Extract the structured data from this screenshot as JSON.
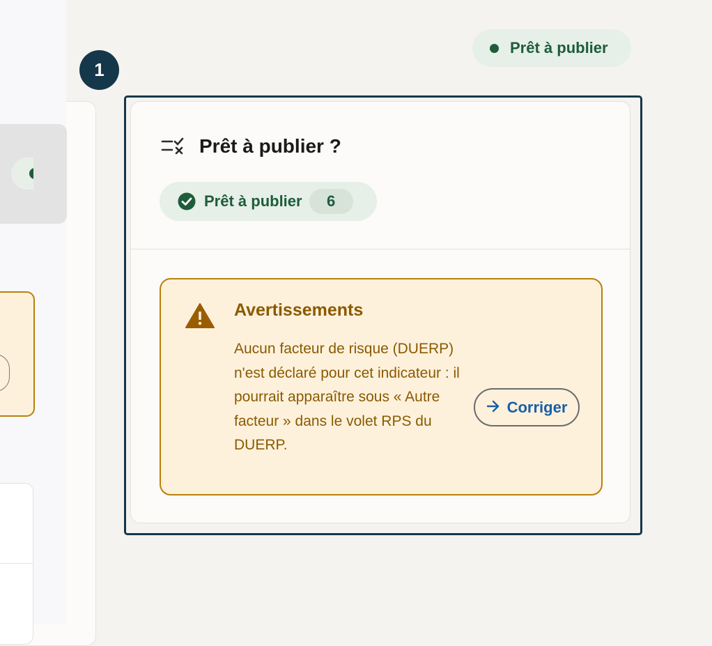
{
  "step_badge": {
    "number": "1"
  },
  "status_pill": {
    "label": "Prêt à publier"
  },
  "card": {
    "title": "Prêt à publier ?",
    "ready_chip": {
      "label": "Prêt à publier",
      "count": "6"
    },
    "warnings": {
      "title": "Avertissements",
      "text": "Aucun facteur de risque (DUERP) n'est déclaré pour cet indicateur : il pourrait apparaître sous « Autre facteur » dans le volet RPS du DUERP.",
      "fix_button_label": "Corriger"
    }
  },
  "icons": {
    "checklist": "checklist-icon",
    "check_circle": "check-circle-icon",
    "warning": "warning-triangle-icon",
    "arrow": "arrow-right-icon"
  },
  "colors": {
    "accent_green": "#1e5c3a",
    "chip_bg": "#e6efe8",
    "frame_navy": "#15374a",
    "warning_text": "#8a5a00",
    "warning_bg": "#fdf1dc",
    "warning_border": "#b8800a",
    "link_blue": "#1a5fa8"
  }
}
